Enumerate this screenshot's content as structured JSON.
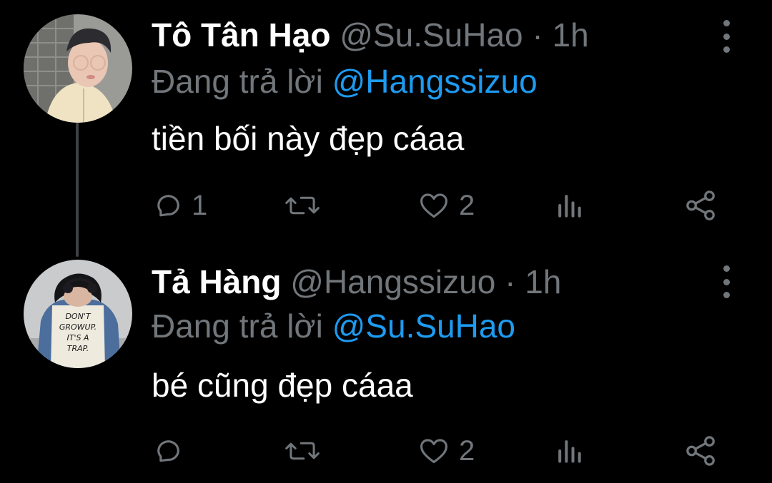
{
  "tweets": [
    {
      "display_name": "Tô Tân Hạo",
      "handle": "@Su.SuHao",
      "separator": "·",
      "time": "1h",
      "reply_prefix": "Đang trả lời",
      "reply_to": "@Hangssizuo",
      "text": "tiền bối này đẹp cáaa",
      "actions": {
        "reply_count": "1",
        "retweet_count": "",
        "like_count": "2"
      },
      "avatar_shirt_text": []
    },
    {
      "display_name": "Tả Hàng",
      "handle": "@Hangssizuo",
      "separator": "·",
      "time": "1h",
      "reply_prefix": "Đang trả lời",
      "reply_to": "@Su.SuHao",
      "text": "bé cũng đẹp cáaa",
      "actions": {
        "reply_count": "",
        "retweet_count": "",
        "like_count": "2"
      },
      "avatar_shirt_text": [
        "DON'T",
        "GROWUP.",
        "IT'S A",
        "TRAP."
      ]
    }
  ],
  "icons": {
    "reply": "reply-icon",
    "retweet": "retweet-icon",
    "like": "heart-icon",
    "views": "views-icon",
    "share": "share-icon",
    "more": "more-vertical-icon"
  },
  "colors": {
    "background": "#000000",
    "primary_text": "#ffffff",
    "secondary_text": "#71767b",
    "link": "#1d9bf0",
    "thread_line": "#3e4144"
  }
}
